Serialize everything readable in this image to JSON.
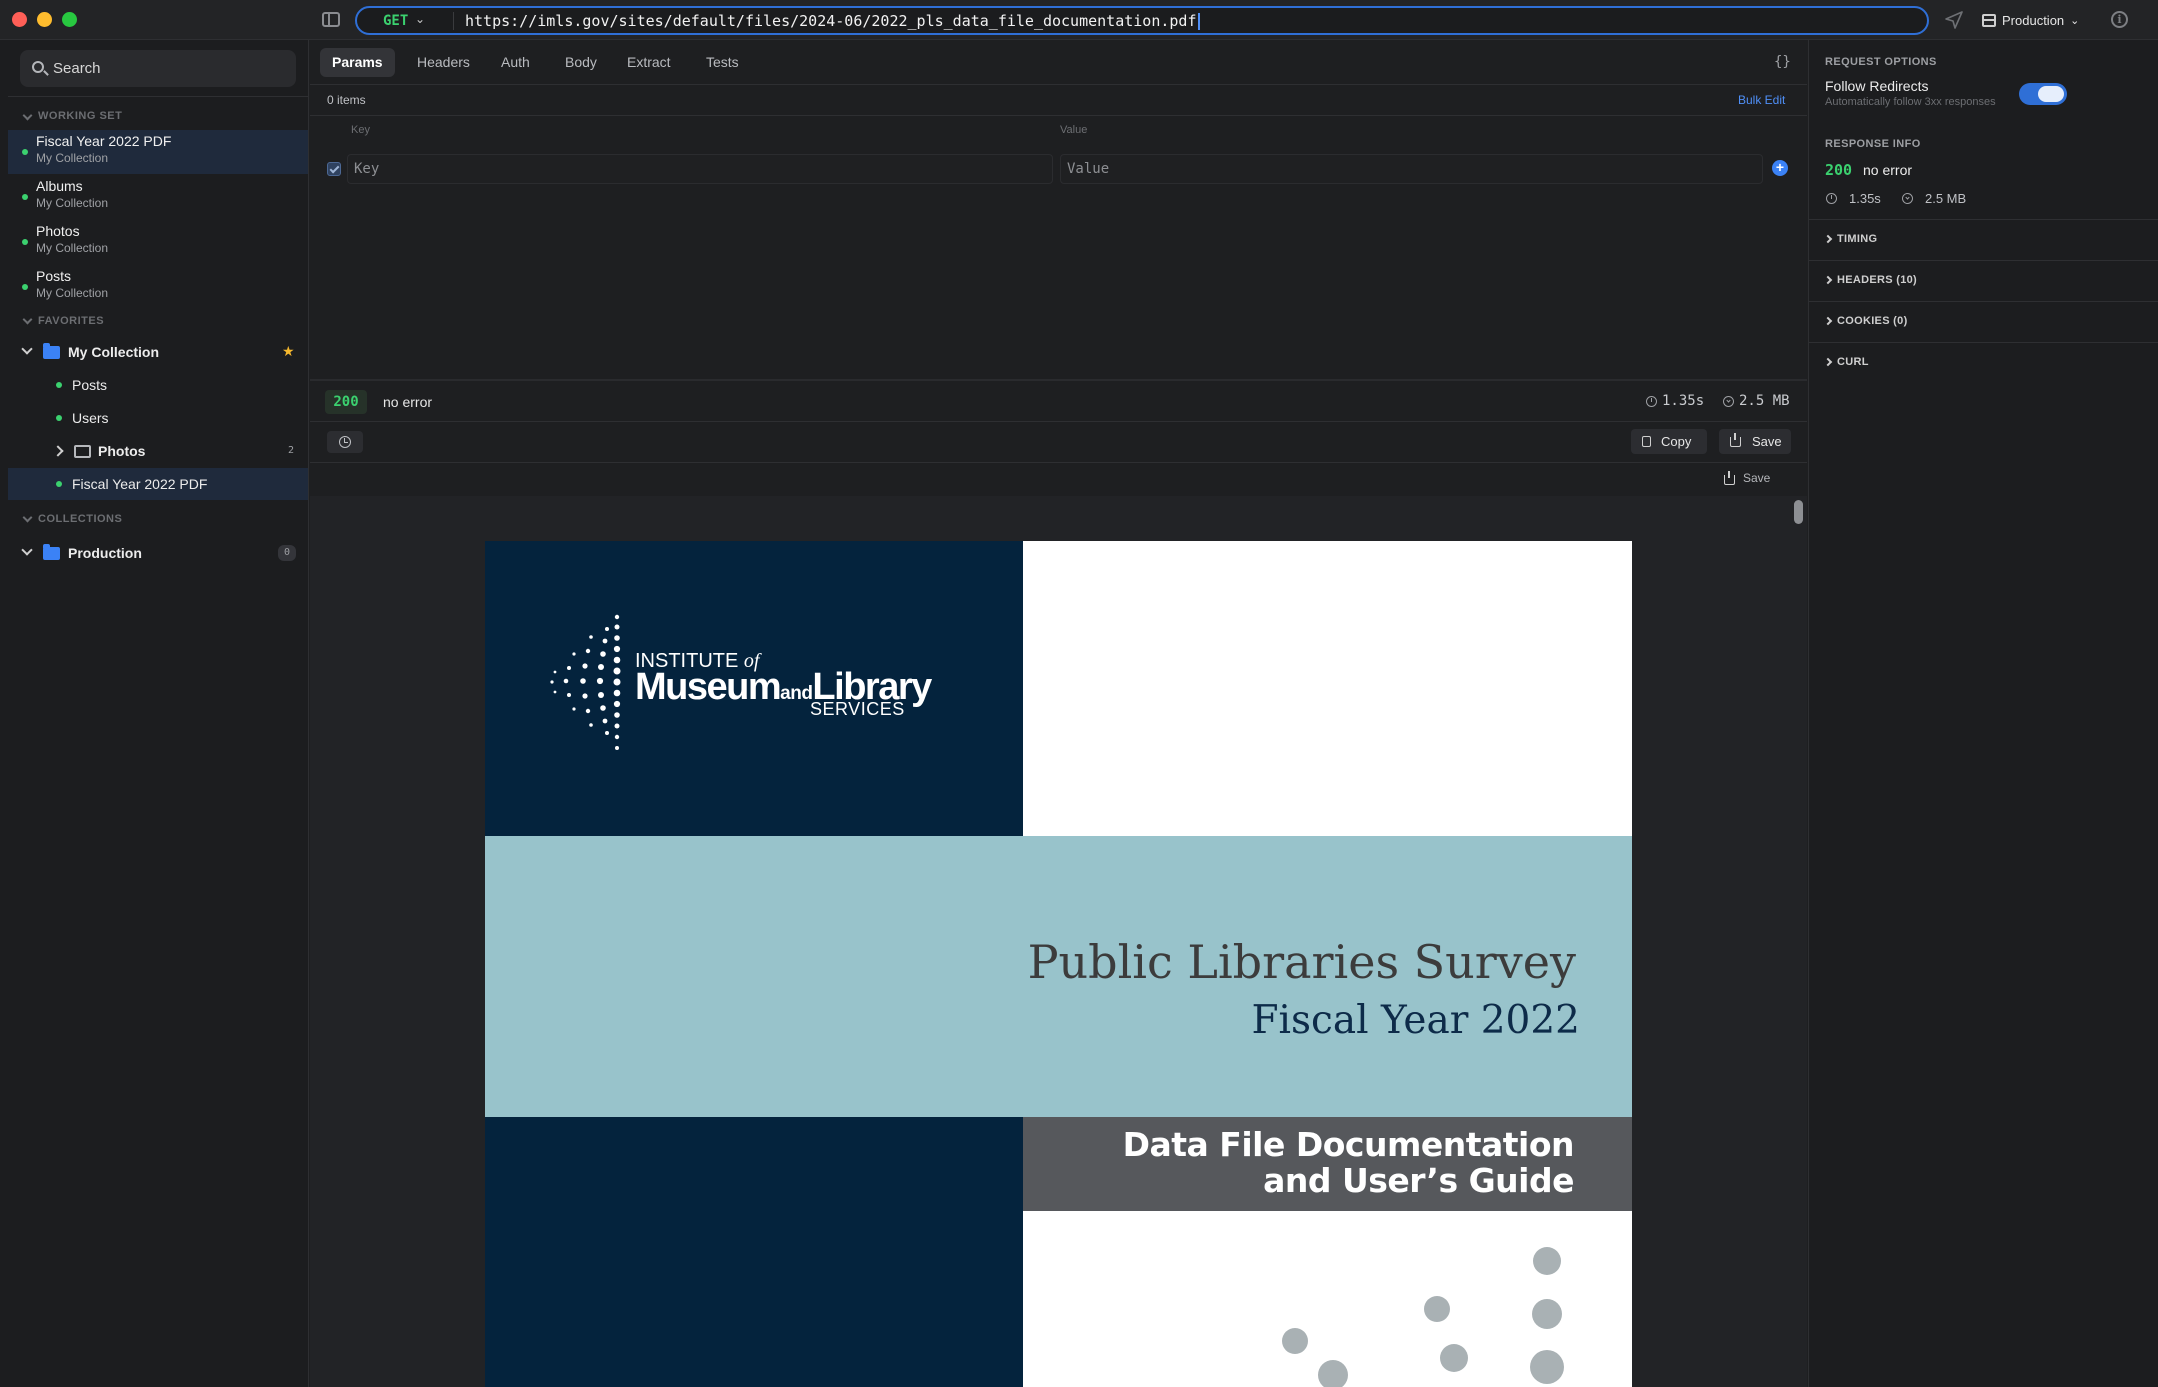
{
  "window": {
    "request_method": "GET",
    "url": "https://imls.gov/sites/default/files/2024-06/2022_pls_data_file_documentation.pdf",
    "environment": "Production"
  },
  "sidebar": {
    "search_label": "Search",
    "working_set_label": "WORKING SET",
    "working_set": [
      {
        "title": "Fiscal Year 2022 PDF",
        "collection": "My Collection"
      },
      {
        "title": "Albums",
        "collection": "My Collection"
      },
      {
        "title": "Photos",
        "collection": "My Collection"
      },
      {
        "title": "Posts",
        "collection": "My Collection"
      }
    ],
    "favorites_label": "FAVORITES",
    "favorite_collection": "My Collection",
    "favorite_items": {
      "posts": "Posts",
      "users": "Users",
      "photos_folder": "Photos",
      "photos_count": "2",
      "fiscal": "Fiscal Year 2022 PDF"
    },
    "collections_label": "COLLECTIONS",
    "production": {
      "label": "Production",
      "count": "0"
    }
  },
  "request": {
    "tabs": [
      "Params",
      "Headers",
      "Auth",
      "Body",
      "Extract",
      "Tests"
    ],
    "active_tab": "Params",
    "braces_label": "{}",
    "items_count": "0 items",
    "bulk_edit": "Bulk Edit",
    "key_header": "Key",
    "value_header": "Value",
    "key_placeholder": "Key",
    "value_placeholder": "Value"
  },
  "response": {
    "status_code": "200",
    "status_text": "no error",
    "time": "1.35s",
    "size": "2.5 MB",
    "copy_label": "Copy",
    "save_label": "Save",
    "viewer_save_label": "Save"
  },
  "pdf": {
    "logo_line1": "INSTITUTE",
    "logo_of": "of",
    "logo_museum": "Museum",
    "logo_and": "and",
    "logo_library": "Library",
    "logo_services": "SERVICES",
    "title": "Public Libraries Survey",
    "subtitle": "Fiscal Year 2022",
    "doc_title_line1": "Data File Documentation",
    "doc_title_line2": "and User’s Guide"
  },
  "right_panel": {
    "request_options_label": "REQUEST OPTIONS",
    "follow_redirects": "Follow Redirects",
    "follow_redirects_desc": "Automatically follow 3xx responses",
    "follow_redirects_on": true,
    "response_info_label": "RESPONSE INFO",
    "status_code": "200",
    "status_text": "no error",
    "time": "1.35s",
    "size": "2.5 MB",
    "sections": [
      "TIMING",
      "HEADERS (10)",
      "COOKIES (0)",
      "CURL"
    ]
  },
  "colors": {
    "accent": "#2f6fd6",
    "success": "#3bd16f",
    "pdf_navy": "#04233d",
    "pdf_band": "#98c3cb",
    "pdf_gray": "#56585c",
    "favorite_star": "#f5b82e"
  }
}
